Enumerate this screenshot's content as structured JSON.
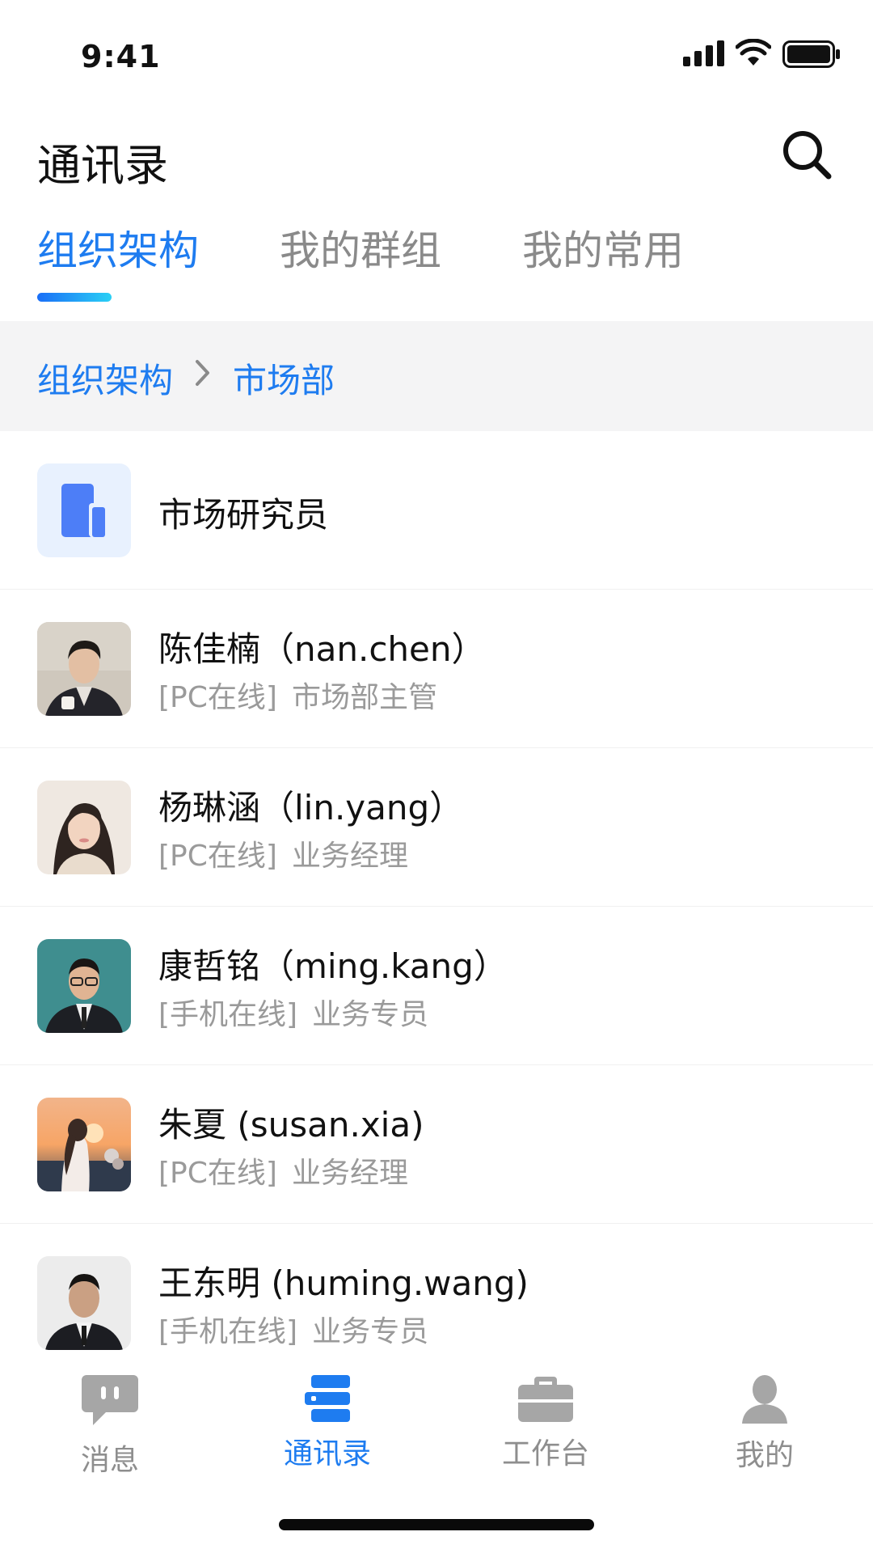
{
  "status_bar": {
    "time": "9:41"
  },
  "header": {
    "title": "通讯录"
  },
  "tabs": [
    {
      "label": "组织架构",
      "active": true
    },
    {
      "label": "我的群组",
      "active": false
    },
    {
      "label": "我的常用",
      "active": false
    }
  ],
  "breadcrumb": {
    "root": "组织架构",
    "current": "市场部"
  },
  "department": {
    "name": "市场研究员",
    "icon": "building-icon"
  },
  "contacts": [
    {
      "name": "陈佳楠（nan.chen）",
      "status": "[PC在线]",
      "role": "市场部主管"
    },
    {
      "name": "杨琳涵（lin.yang）",
      "status": "[PC在线]",
      "role": "业务经理"
    },
    {
      "name": "康哲铭（ming.kang）",
      "status": "[手机在线]",
      "role": "业务专员"
    },
    {
      "name": "朱夏 (susan.xia)",
      "status": "[PC在线]",
      "role": "业务经理"
    },
    {
      "name": "王东明 (huming.wang)",
      "status": "[手机在线]",
      "role": "业务专员"
    }
  ],
  "bottom_nav": [
    {
      "label": "消息",
      "icon": "chat-bubble-icon",
      "active": false
    },
    {
      "label": "通讯录",
      "icon": "contacts-icon",
      "active": true
    },
    {
      "label": "工作台",
      "icon": "briefcase-icon",
      "active": false
    },
    {
      "label": "我的",
      "icon": "person-icon",
      "active": false
    }
  ],
  "colors": {
    "accent": "#1e7cf0",
    "muted": "#9a9a9a",
    "breadcrumb_bg": "#f4f4f5"
  }
}
